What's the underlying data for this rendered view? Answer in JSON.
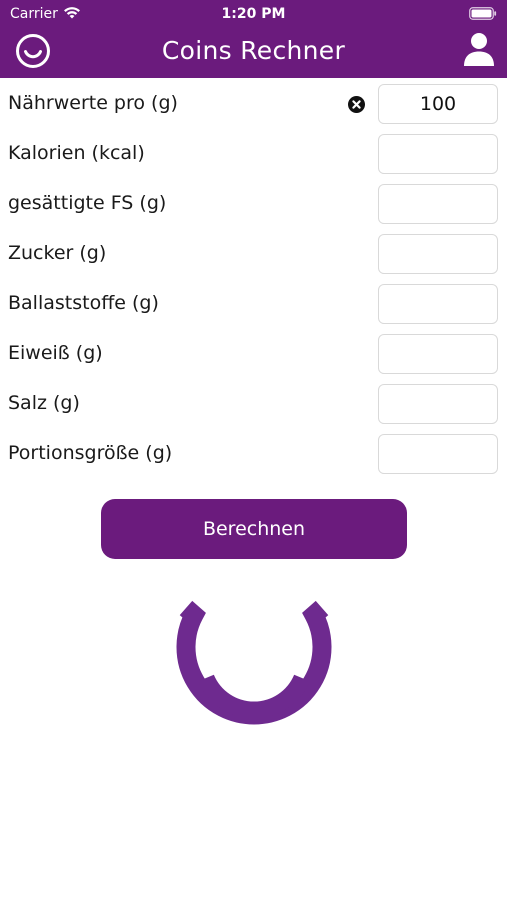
{
  "status_bar": {
    "carrier": "Carrier",
    "time": "1:20 PM"
  },
  "nav": {
    "title": "Coins Rechner",
    "left_icon": "smile-logo-icon",
    "right_icon": "user-icon"
  },
  "form": {
    "rows": [
      {
        "label": "Nährwerte pro (g)",
        "value": "100",
        "placeholder": ""
      },
      {
        "label": "Kalorien (kcal)",
        "value": "",
        "placeholder": ""
      },
      {
        "label": "gesättigte FS (g)",
        "value": "",
        "placeholder": ""
      },
      {
        "label": "Zucker (g)",
        "value": "",
        "placeholder": ""
      },
      {
        "label": "Ballaststoffe (g)",
        "value": "",
        "placeholder": ""
      },
      {
        "label": "Eiweiß (g)",
        "value": "",
        "placeholder": ""
      },
      {
        "label": "Salz (g)",
        "value": "",
        "placeholder": ""
      },
      {
        "label": "Portionsgröße (g)",
        "value": "",
        "placeholder": ""
      }
    ]
  },
  "actions": {
    "calculate_label": "Berechnen"
  },
  "colors": {
    "brand": "#6b1b7d",
    "brand_logo": "#6e2a8f",
    "field_border": "#d9d9d9",
    "text": "#1a1a1a"
  }
}
